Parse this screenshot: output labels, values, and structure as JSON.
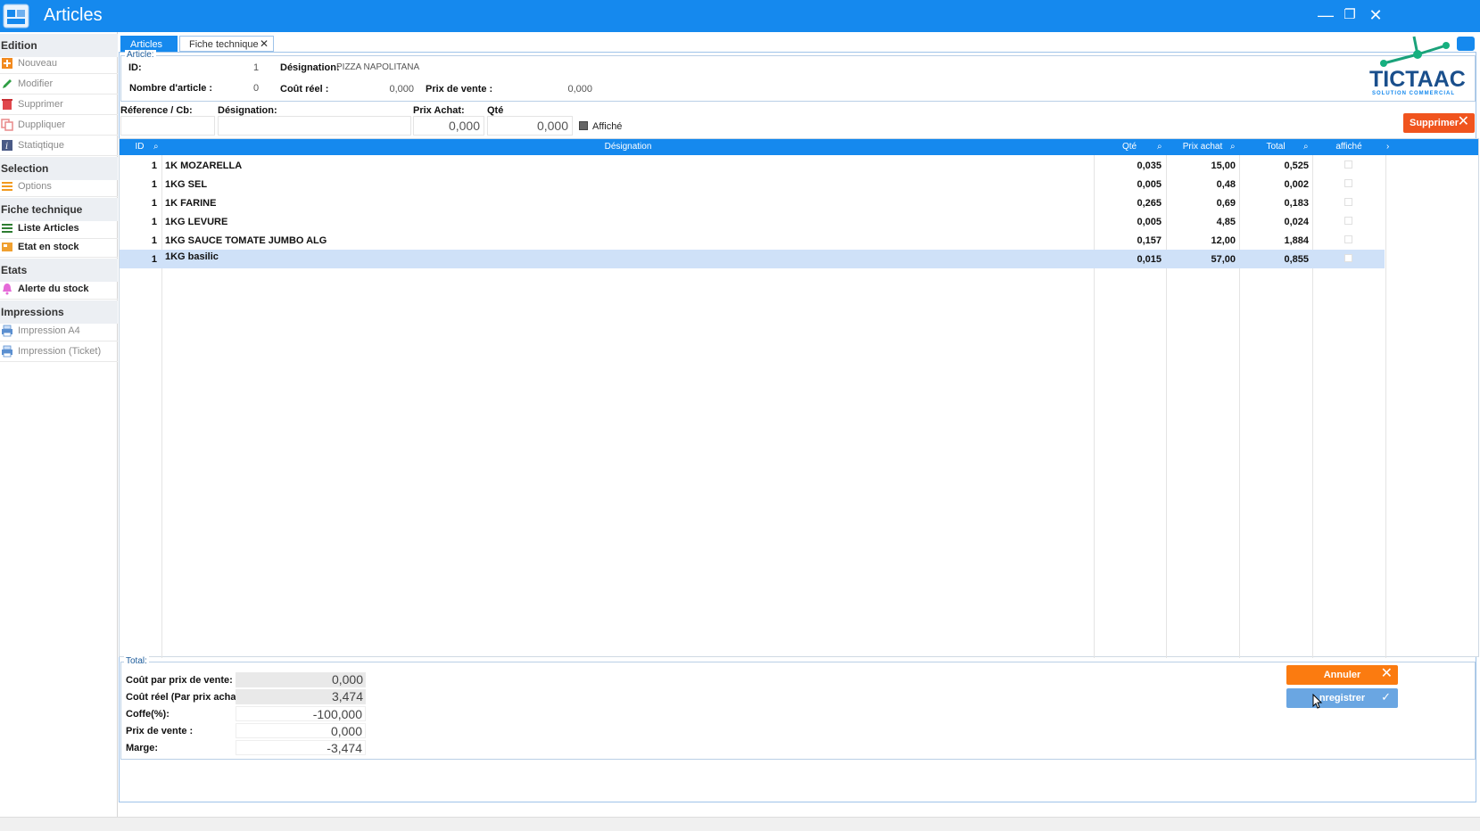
{
  "window": {
    "title": "Articles",
    "minimize": "—",
    "maximize": "❐",
    "close": "✕"
  },
  "sidebar": {
    "sections": [
      {
        "label": "Edition"
      },
      {
        "label": "Selection"
      },
      {
        "label": "Fiche technique"
      },
      {
        "label": "Etats"
      },
      {
        "label": "Impressions"
      }
    ],
    "items": {
      "nouveau": "Nouveau",
      "modifier": "Modifier",
      "supprimer": "Supprimer",
      "dupliquer": "Duppliquer",
      "statistique": "Statiqtique",
      "options": "Options",
      "liste_articles": "Liste Articles",
      "etat_stock": "Etat en stock",
      "alerte_stock": "Alerte du stock",
      "impression_a4": "Impression A4",
      "impression_ticket": "Impression (Ticket)"
    }
  },
  "tabs": {
    "articles": "Articles",
    "fiche": "Fiche technique",
    "close": "✕"
  },
  "article": {
    "legend": "Article:",
    "id_label": "ID:",
    "id_value": "1",
    "designation_label": "Désignation:",
    "designation_value": "PIZZA NAPOLITANA",
    "nombre_label": "Nombre d'article :",
    "nombre_value": "0",
    "cout_reel_label": "Coût réel :",
    "cout_reel_value": "0,000",
    "prix_vente_label": "Prix de vente :",
    "prix_vente_value": "0,000"
  },
  "logo": {
    "brand": "TICTAAC",
    "tagline": "SOLUTION COMMERCIAL"
  },
  "entry": {
    "reference_label": "Réference / Cb:",
    "designation_label": "Désignation:",
    "prix_achat_label": "Prix Achat:",
    "qte_label": "Qté",
    "prix_achat_value": "0,000",
    "qte_value": "0,000",
    "affiche_label": "Affiché",
    "supprimer_label": "Supprimer",
    "x": "✕"
  },
  "grid": {
    "columns": {
      "id": "ID",
      "designation": "Désignation",
      "qte": "Qté",
      "prix_achat": "Prix achat",
      "total": "Total",
      "affiche": "affiché"
    },
    "rows": [
      {
        "id": "1",
        "designation": "1K MOZARELLA",
        "qte": "0,035",
        "prix_achat": "15,00",
        "total": "0,525"
      },
      {
        "id": "1",
        "designation": "1KG SEL",
        "qte": "0,005",
        "prix_achat": "0,48",
        "total": "0,002"
      },
      {
        "id": "1",
        "designation": "1K FARINE",
        "qte": "0,265",
        "prix_achat": "0,69",
        "total": "0,183"
      },
      {
        "id": "1",
        "designation": "1KG LEVURE",
        "qte": "0,005",
        "prix_achat": "4,85",
        "total": "0,024"
      },
      {
        "id": "1",
        "designation": "1KG SAUCE TOMATE JUMBO ALG",
        "qte": "0,157",
        "prix_achat": "12,00",
        "total": "1,884"
      },
      {
        "id": "1",
        "designation": "1KG basilic",
        "qte": "0,015",
        "prix_achat": "57,00",
        "total": "0,855"
      }
    ]
  },
  "totals": {
    "legend": "Total:",
    "cout_prix_vente_label": "Coût par prix de vente:",
    "cout_prix_vente_value": "0,000",
    "cout_reel_label": "Coût réel (Par prix achat):",
    "cout_reel_value": "3,474",
    "coffe_label": "Coffe(%):",
    "coffe_value": "-100,000",
    "prix_vente_label": "Prix de vente :",
    "prix_vente_value": "0,000",
    "marge_label": "Marge:",
    "marge_value": "-3,474"
  },
  "actions": {
    "annuler": "Annuler",
    "enregistrer": "nregistrer",
    "x": "✕",
    "check": "✓"
  },
  "colors": {
    "accent": "#1589ee",
    "danger": "#f0541e",
    "warning": "#fb7b10",
    "selected_row": "#cfe1f8"
  }
}
